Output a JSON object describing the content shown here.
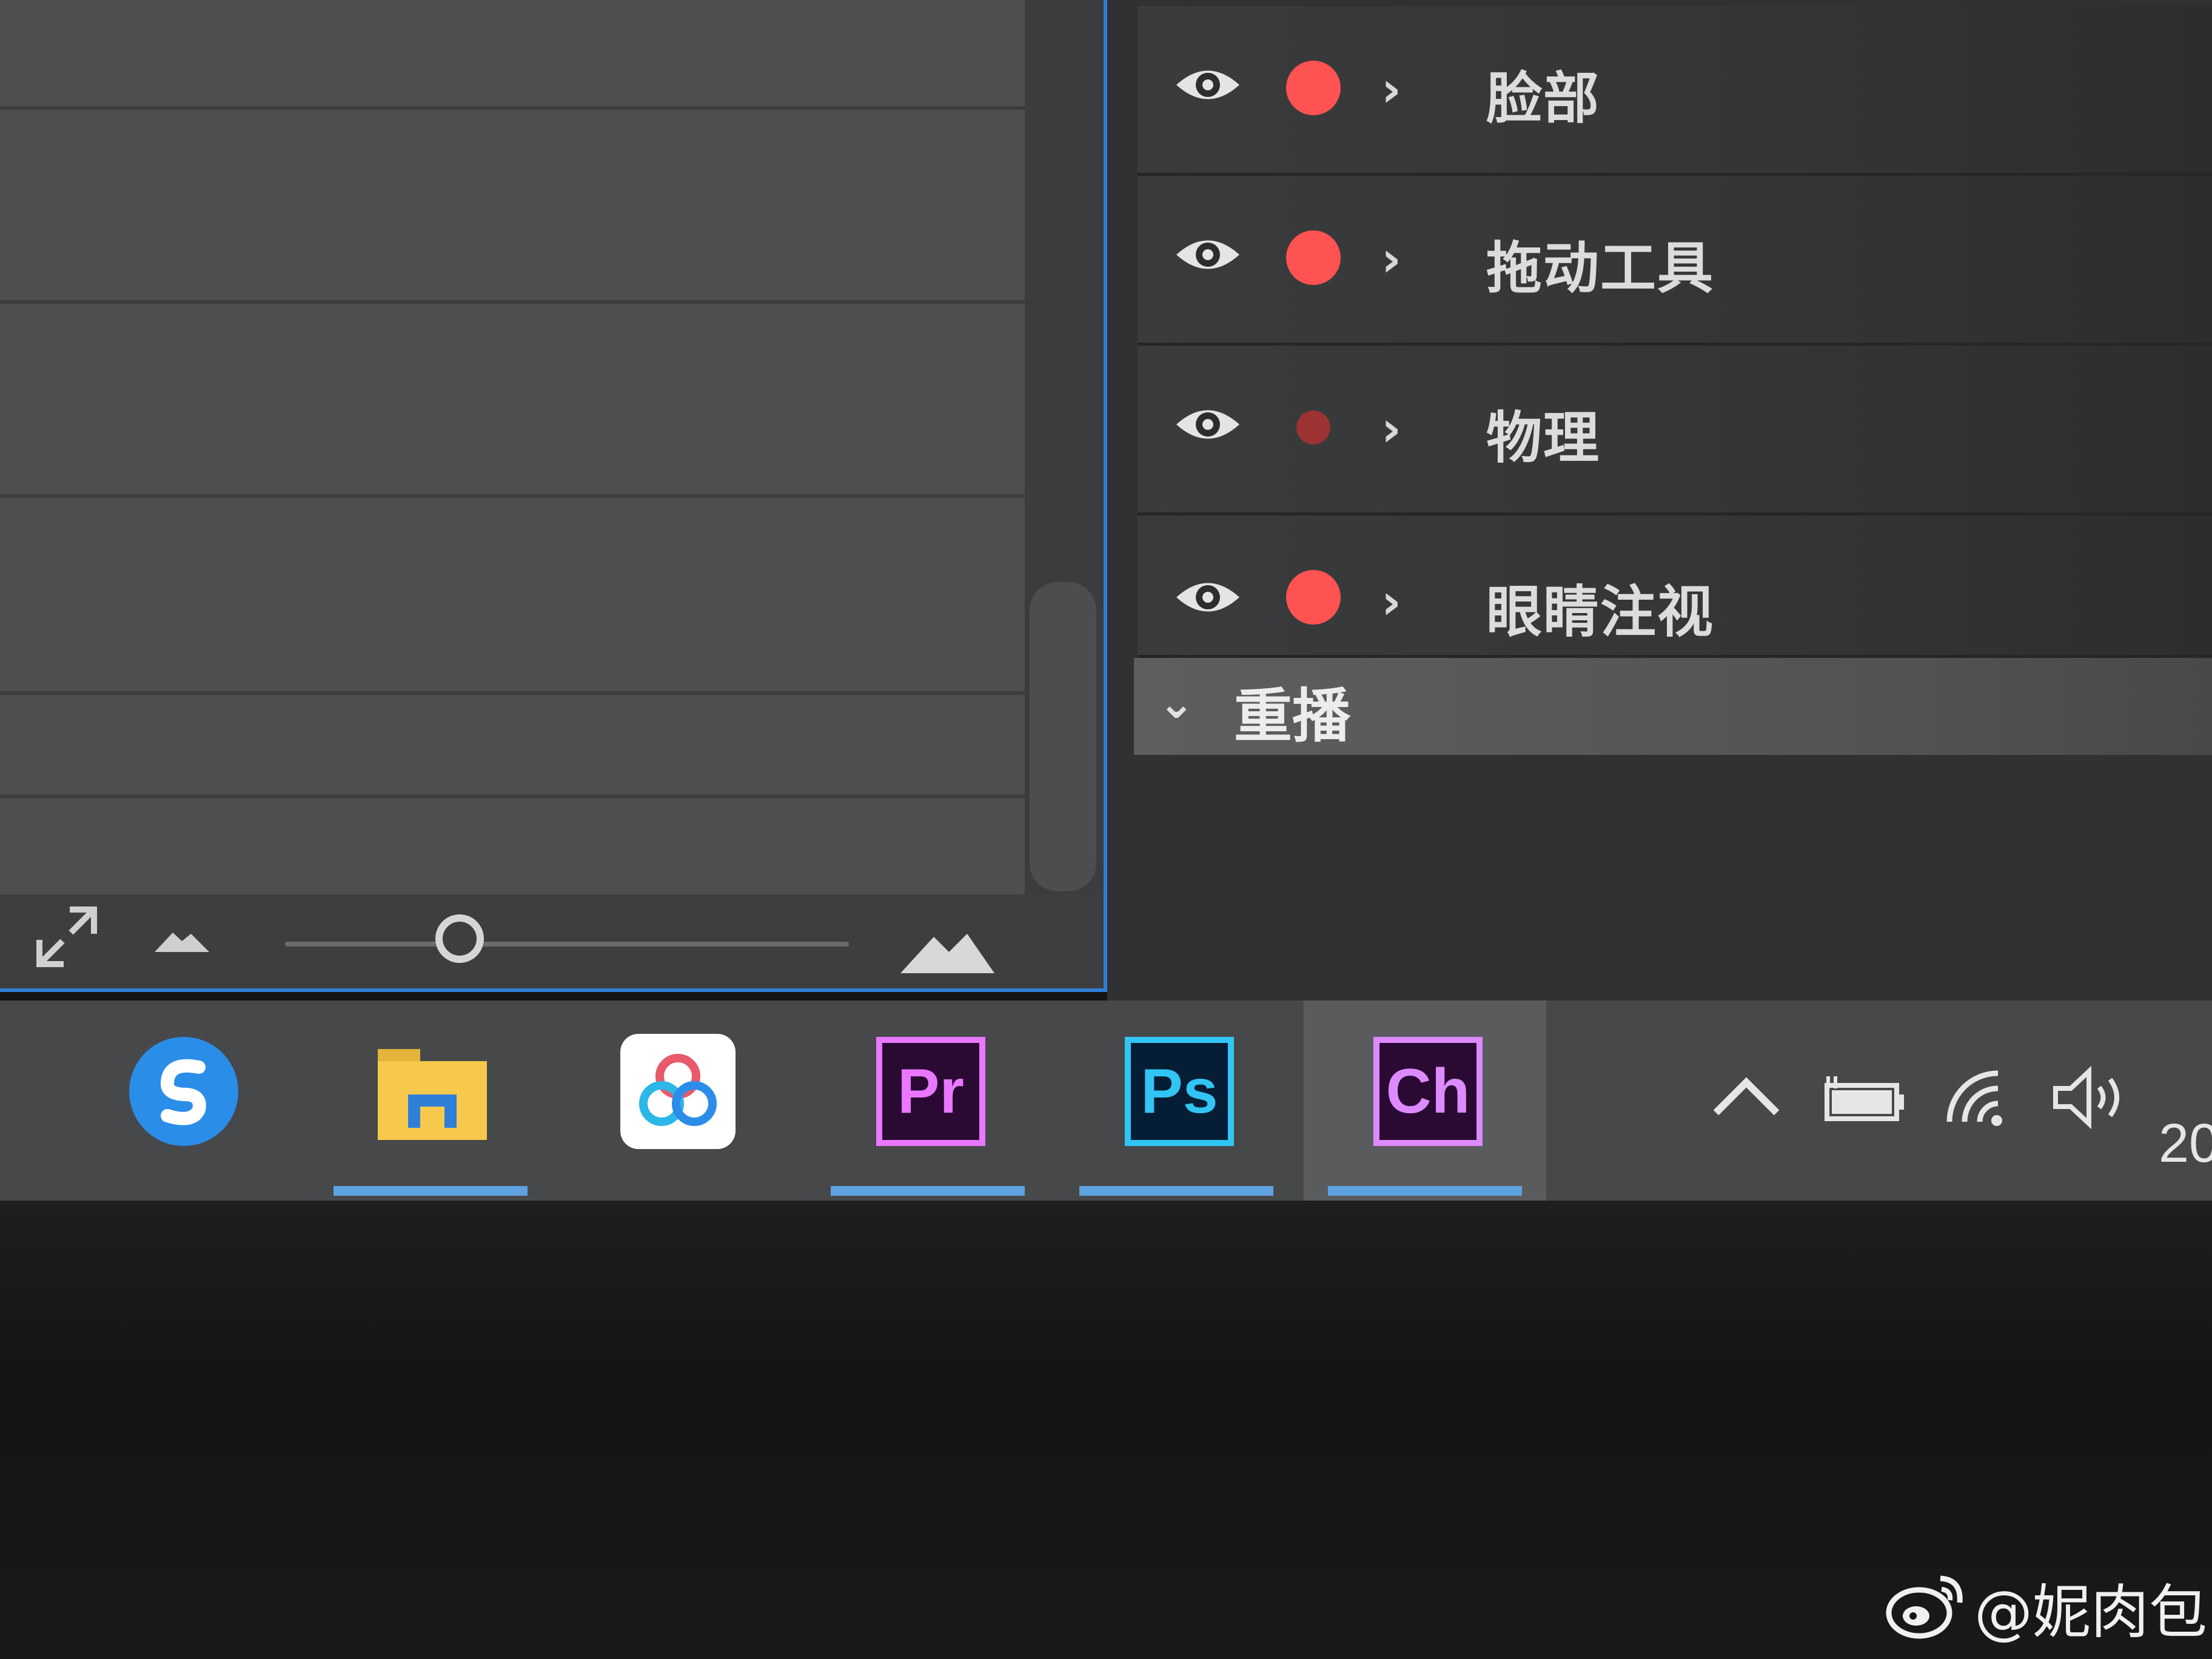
{
  "layers": [
    {
      "label": "脸部"
    },
    {
      "label": "拖动工具"
    },
    {
      "label": "物理"
    },
    {
      "label": "眼睛注视"
    }
  ],
  "section": {
    "label": "重播",
    "expanded": true
  },
  "taskbar": {
    "apps": [
      {
        "icon": "sogou-icon"
      },
      {
        "icon": "file-explorer-icon",
        "running": true
      },
      {
        "icon": "baidu-netdisk-icon"
      },
      {
        "icon": "premiere-icon",
        "text": "Pr",
        "running": true
      },
      {
        "icon": "photoshop-icon",
        "text": "Ps",
        "running": true
      },
      {
        "icon": "character-animator-icon",
        "text": "Ch",
        "running": true,
        "active": true
      }
    ],
    "clock": "20"
  },
  "colors": {
    "accent_blue": "#2f7fd8",
    "record_dot": "#ff5252",
    "pr": "#ea77ff",
    "ps": "#31c5f4",
    "ch": "#dd8aff"
  },
  "watermark": "@妮肉包"
}
